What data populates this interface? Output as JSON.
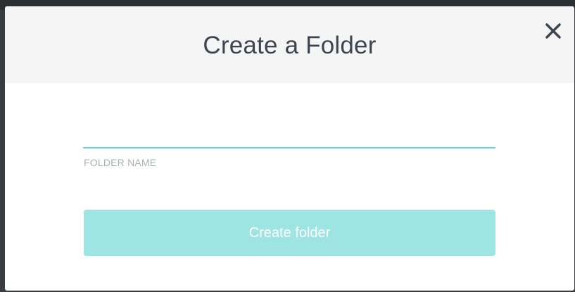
{
  "dialog": {
    "title": "Create a Folder",
    "close_icon": "close-icon"
  },
  "form": {
    "folder_name": {
      "value": "",
      "label": "FOLDER NAME",
      "accent_color": "#6ccfd0"
    },
    "submit_label": "Create folder",
    "submit_color": "#9de4e3"
  }
}
